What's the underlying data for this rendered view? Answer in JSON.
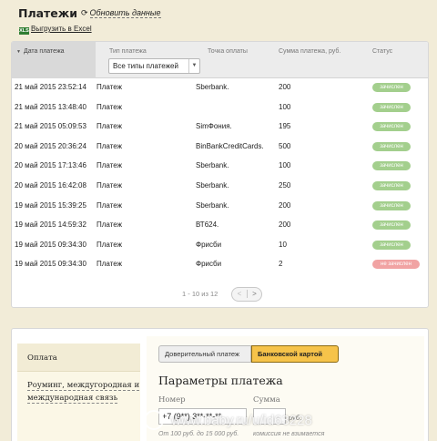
{
  "header": {
    "title": "Платежи",
    "refresh_label": "Обновить данные",
    "export_icon_text": "XLS",
    "export_label": "Выгрузить в Excel"
  },
  "table": {
    "columns": [
      "Дата платежа",
      "Тип платежа",
      "Точка оплаты",
      "Сумма платежа, руб.",
      "Статус"
    ],
    "type_filter_value": "Все типы платежей",
    "rows": [
      {
        "date": "21 май 2015  23:52:14",
        "type": "Платеж",
        "point": "Sberbank.",
        "sum": "200",
        "status": "зачислен",
        "ok": true
      },
      {
        "date": "21 май 2015  13:48:40",
        "type": "Платеж",
        "point": "",
        "sum": "100",
        "status": "зачислен",
        "ok": true
      },
      {
        "date": "21 май 2015  05:09:53",
        "type": "Платеж",
        "point": "SimФония.",
        "sum": "195",
        "status": "зачислен",
        "ok": true
      },
      {
        "date": "20 май 2015  20:36:24",
        "type": "Платеж",
        "point": "BinBankCreditCards.",
        "sum": "500",
        "status": "зачислен",
        "ok": true
      },
      {
        "date": "20 май 2015  17:13:46",
        "type": "Платеж",
        "point": "Sberbank.",
        "sum": "100",
        "status": "зачислен",
        "ok": true
      },
      {
        "date": "20 май 2015  16:42:08",
        "type": "Платеж",
        "point": "Sberbank.",
        "sum": "250",
        "status": "зачислен",
        "ok": true
      },
      {
        "date": "19 май 2015  15:39:25",
        "type": "Платеж",
        "point": "Sberbank.",
        "sum": "200",
        "status": "зачислен",
        "ok": true
      },
      {
        "date": "19 май 2015  14:59:32",
        "type": "Платеж",
        "point": "ВТ624.",
        "sum": "200",
        "status": "зачислен",
        "ok": true
      },
      {
        "date": "19 май 2015  09:34:30",
        "type": "Платеж",
        "point": "Фрисби",
        "sum": "10",
        "status": "зачислен",
        "ok": true
      },
      {
        "date": "19 май 2015  09:34:30",
        "type": "Платеж",
        "point": "Фрисби",
        "sum": "2",
        "status": "не зачислен",
        "ok": false
      }
    ],
    "pagination": "1 - 10 из 12"
  },
  "payment": {
    "sidebar_active": "Оплата",
    "sidebar_item": "Роуминг, междугородная и международная связь",
    "tab_inactive": "Доверительный платеж",
    "tab_active": "Банковской картой",
    "title": "Параметры платежа",
    "phone_label": "Номер",
    "sum_label": "Сумма",
    "phone_value": "+7 (9**) 3**-**-**",
    "currency": "руб.",
    "amount_hint": "От 100 руб. до 15 000 руб.",
    "commission_hint": "комиссия не взимается"
  },
  "watermark": "www.baby.ru/u/id63228",
  "colors": {
    "page_bg": "#f2ecd8",
    "status_ok": "#a3cf8d",
    "status_fail": "#f1a3a3",
    "active_tab": "#f6c34a"
  }
}
